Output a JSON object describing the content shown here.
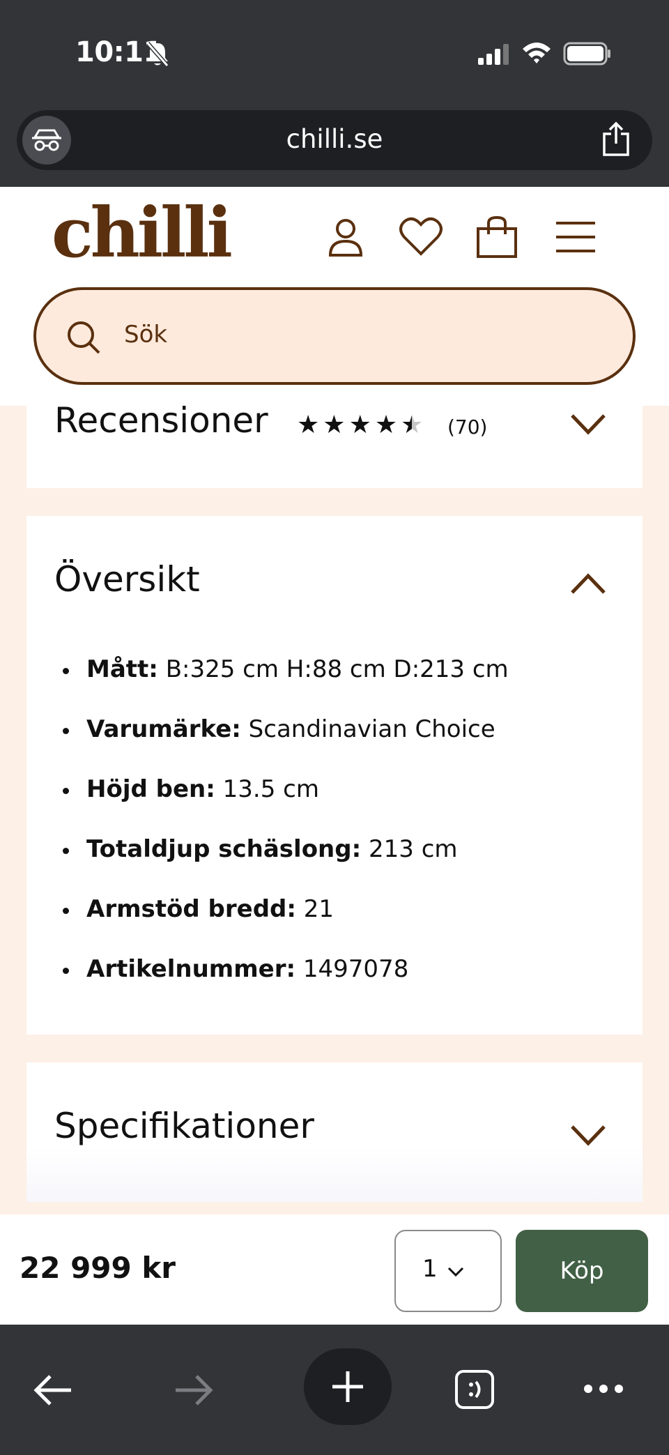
{
  "status_bar": {
    "time": "10:11"
  },
  "browser": {
    "url": "chilli.se"
  },
  "header": {
    "logo": "chilli",
    "search_placeholder": "Sök"
  },
  "reviews": {
    "title": "Recensioner",
    "rating": 4.5,
    "count": "(70)"
  },
  "overview": {
    "title": "Översikt",
    "items": [
      {
        "label": "Mått:",
        "value": " B:325 cm H:88 cm D:213 cm"
      },
      {
        "label": "Varumärke:",
        "value": " Scandinavian Choice"
      },
      {
        "label": "Höjd ben:",
        "value": " 13.5 cm"
      },
      {
        "label": "Totaldjup schäslong:",
        "value": " 213 cm"
      },
      {
        "label": "Armstöd bredd:",
        "value": " 21"
      },
      {
        "label": "Artikelnummer:",
        "value": " 1497078"
      }
    ]
  },
  "specifications": {
    "title": "Specifikationer"
  },
  "buy_bar": {
    "price": "22 999 kr",
    "quantity": "1",
    "buy_label": "Köp"
  },
  "colors": {
    "brand_brown": "#5a300f",
    "buy_green": "#426045",
    "page_bg": "#fdf0e7"
  }
}
